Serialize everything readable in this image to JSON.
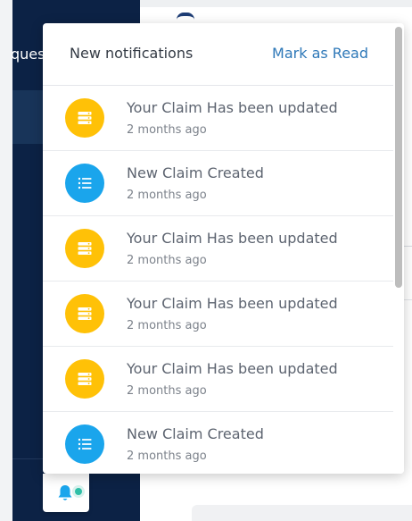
{
  "sidebar": {
    "partial_text": "ques"
  },
  "notifications": {
    "title": "New notifications",
    "mark_read_label": "Mark as Read",
    "items": [
      {
        "type": "updated",
        "icon": "server-icon",
        "message": "Your Claim Has been updated",
        "time": "2 months ago"
      },
      {
        "type": "created",
        "icon": "list-icon",
        "message": "New Claim Created",
        "time": "2 months ago"
      },
      {
        "type": "updated",
        "icon": "server-icon",
        "message": "Your Claim Has been updated",
        "time": "2 months ago"
      },
      {
        "type": "updated",
        "icon": "server-icon",
        "message": "Your Claim Has been updated",
        "time": "2 months ago"
      },
      {
        "type": "updated",
        "icon": "server-icon",
        "message": "Your Claim Has been updated",
        "time": "2 months ago"
      },
      {
        "type": "created",
        "icon": "list-icon",
        "message": "New Claim Created",
        "time": "2 months ago"
      }
    ]
  },
  "colors": {
    "sidebar_bg": "#0c2245",
    "updated_icon": "#ffc107",
    "created_icon": "#1aa5ec",
    "link": "#2e78b8",
    "bell": "#1aa5ec",
    "bell_dot": "#2fbfa7"
  },
  "bell": {
    "icon": "bell-icon",
    "has_unread": true
  }
}
